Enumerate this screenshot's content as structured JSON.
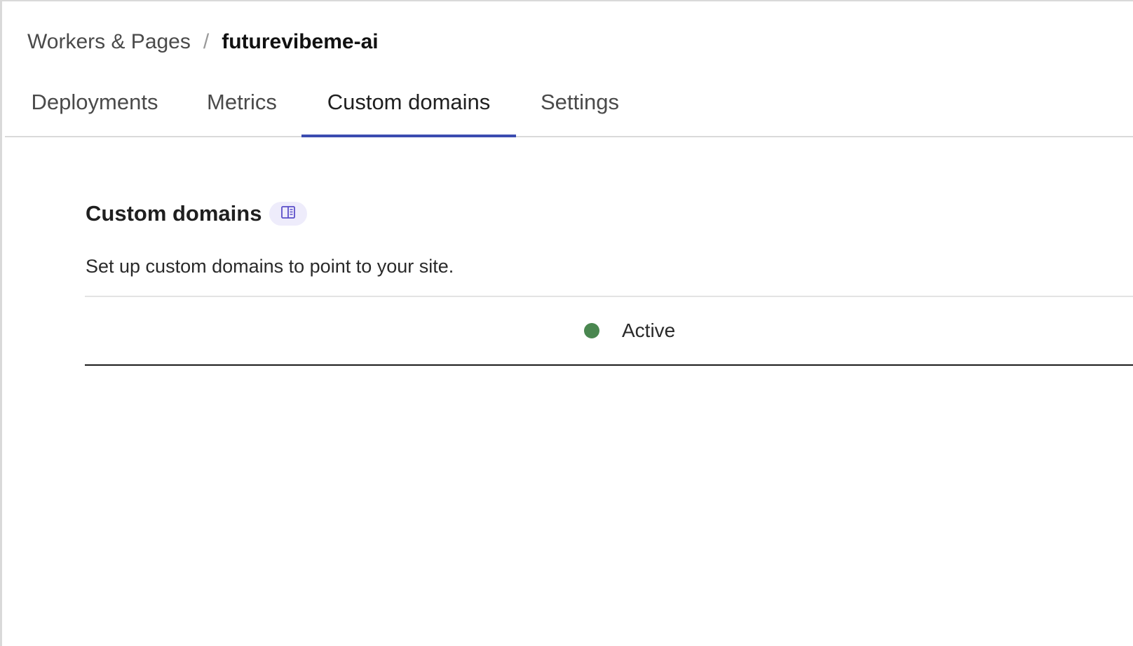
{
  "breadcrumb": {
    "parent": "Workers & Pages",
    "separator": "/",
    "current": "futurevibeme-ai"
  },
  "tabs": [
    {
      "label": "Deployments",
      "active": false
    },
    {
      "label": "Metrics",
      "active": false
    },
    {
      "label": "Custom domains",
      "active": true
    },
    {
      "label": "Settings",
      "active": false
    }
  ],
  "section": {
    "title": "Custom domains",
    "docs_icon": "book-icon",
    "description": "Set up custom domains to point to your site."
  },
  "domains": [
    {
      "status": "Active",
      "status_color": "#4a8750"
    }
  ],
  "colors": {
    "accent": "#3b4bb0",
    "docs_badge_bg": "#eeecfb",
    "docs_icon": "#5b4fc9",
    "active": "#4a8750"
  }
}
